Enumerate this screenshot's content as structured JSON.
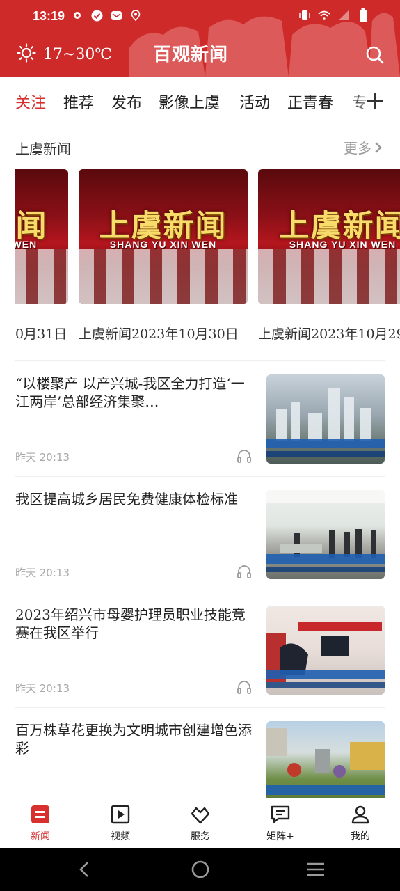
{
  "status_bar": {
    "time": "13:19",
    "left_icons": [
      "gear-icon",
      "check-circle-icon",
      "mail-icon",
      "location-icon"
    ],
    "right_icons": [
      "vibrate-icon",
      "wifi-icon",
      "signal-icon",
      "battery-icon"
    ]
  },
  "header": {
    "temperature": "17~30℃",
    "app_name": "百观新闻",
    "weather_icon": "sun-icon",
    "search_icon": "search-icon",
    "color": "#cf2a2a"
  },
  "tabs": {
    "items": [
      {
        "label": "关注",
        "active": true
      },
      {
        "label": "推荐",
        "active": false
      },
      {
        "label": "发布",
        "active": false
      },
      {
        "label": "影像上虞",
        "active": false
      },
      {
        "label": "活动",
        "active": false
      },
      {
        "label": "正青春",
        "active": false
      },
      {
        "label": "专",
        "active": false
      }
    ],
    "active_color": "#d7302f"
  },
  "section": {
    "title": "上虞新闻",
    "more_label": "更多"
  },
  "carousel": {
    "cards": [
      {
        "caption": "0月31日",
        "thumb_title": "上虞新闻",
        "thumb_subtitle": "SHANG YU  XIN WEN"
      },
      {
        "caption": "上虞新闻2023年10月30日",
        "thumb_title": "上虞新闻",
        "thumb_subtitle": "SHANG YU  XIN WEN"
      },
      {
        "caption": "上虞新闻2023年10月29",
        "thumb_title": "上虞新闻",
        "thumb_subtitle": "SHANG YU  XIN WEN"
      }
    ]
  },
  "news": [
    {
      "title": "“以楼聚产 以产兴城-我区全力打造‘一江两岸’总部经济集聚…",
      "time": "昨天  20:13"
    },
    {
      "title": "我区提高城乡居民免费健康体检标准",
      "time": "昨天  20:13"
    },
    {
      "title": "2023年绍兴市母婴护理员职业技能竞赛在我区举行",
      "time": "昨天  20:13"
    },
    {
      "title": "百万株草花更换为文明城市创建增色添彩",
      "time": ""
    }
  ],
  "bottom_nav": {
    "items": [
      {
        "label": "新闻",
        "icon": "news-icon",
        "active": true
      },
      {
        "label": "视频",
        "icon": "video-icon",
        "active": false
      },
      {
        "label": "服务",
        "icon": "service-icon",
        "active": false
      },
      {
        "label": "矩阵+",
        "icon": "matrix-icon",
        "active": false
      },
      {
        "label": "我的",
        "icon": "profile-icon",
        "active": false
      }
    ]
  }
}
